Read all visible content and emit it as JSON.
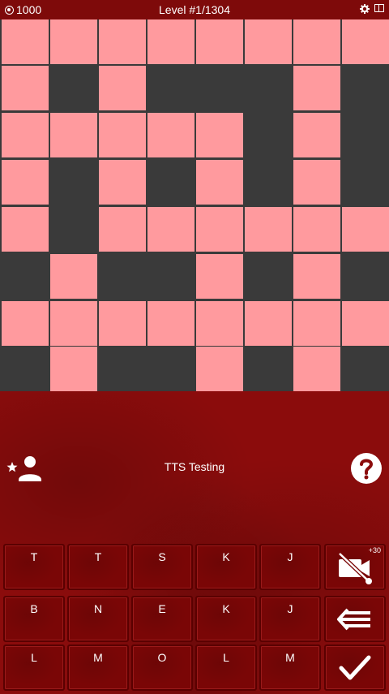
{
  "status_bar": {
    "coins": "1000",
    "level": "Level #1/1304",
    "icons": [
      "coin-icon",
      "gear-icon",
      "dual-screen-icon"
    ]
  },
  "colors": {
    "status_bar_bg": "#7e0a0a",
    "cell_open": "#ff9a9e",
    "cell_blocked": "#3a3a3a",
    "panel_bg": "#8b0c0c",
    "key_bg": "#7a0606"
  },
  "grid": {
    "rows": 8,
    "cols": 8,
    "layout": [
      "11111111",
      "10100010",
      "11111010",
      "10101010",
      "10111111",
      "01001010",
      "11111111",
      "01001010"
    ]
  },
  "clue": {
    "text": "TTS Testing",
    "left_icon": "user-star-icon",
    "right_icon": "help-icon"
  },
  "keyboard": {
    "rows": [
      [
        "T",
        "T",
        "S",
        "K",
        "J"
      ],
      [
        "B",
        "N",
        "E",
        "K",
        "J"
      ],
      [
        "L",
        "M",
        "O",
        "L",
        "M"
      ]
    ],
    "actions": [
      {
        "icon": "video-off-icon",
        "badge": "+30"
      },
      {
        "icon": "backspace-icon"
      },
      {
        "icon": "check-icon"
      }
    ]
  }
}
